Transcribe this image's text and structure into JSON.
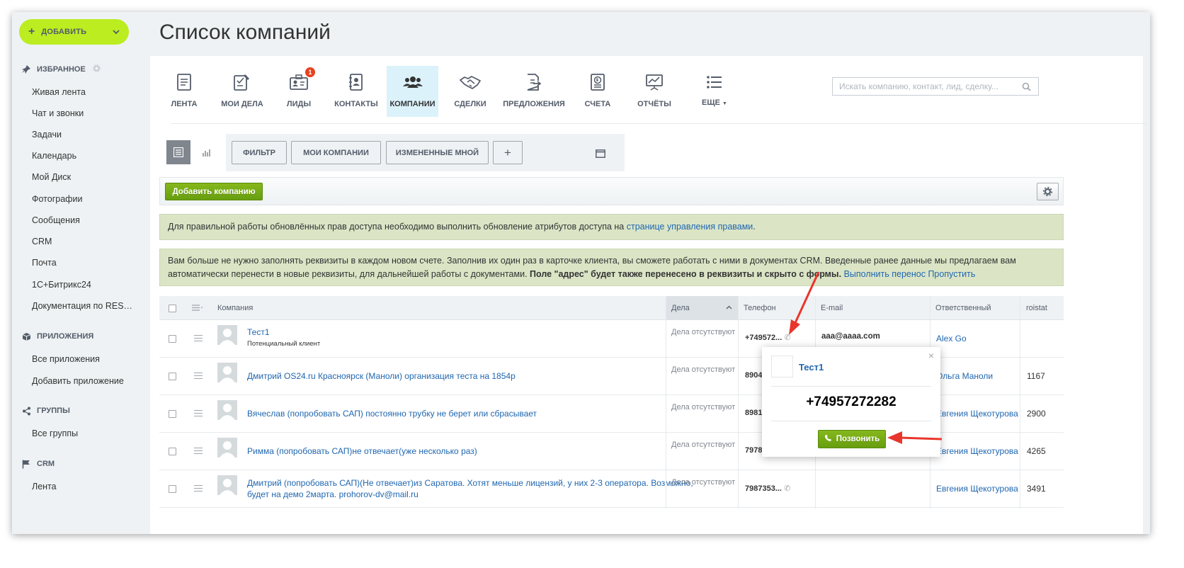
{
  "add_button": {
    "label": "ДОБАВИТЬ"
  },
  "sidebar": {
    "favorites_title": "ИЗБРАННОЕ",
    "favorites": [
      "Живая лента",
      "Чат и звонки",
      "Задачи",
      "Календарь",
      "Мой Диск",
      "Фотографии",
      "Сообщения",
      "CRM",
      "Почта",
      "1С+Битрикс24",
      "Документация по RES…"
    ],
    "apps_title": "ПРИЛОЖЕНИЯ",
    "apps": [
      "Все приложения",
      "Добавить приложение"
    ],
    "groups_title": "ГРУППЫ",
    "groups": [
      "Все группы"
    ],
    "crm_title": "CRM",
    "crm": [
      "Лента"
    ]
  },
  "page_title": "Список компаний",
  "nav_tabs": [
    {
      "label": "ЛЕНТА",
      "icon": "feed-icon"
    },
    {
      "label": "МОИ ДЕЛА",
      "icon": "tasks-icon"
    },
    {
      "label": "ЛИДЫ",
      "icon": "leads-icon",
      "badge": "1"
    },
    {
      "label": "КОНТАКТЫ",
      "icon": "contacts-icon"
    },
    {
      "label": "КОМПАНИИ",
      "icon": "companies-icon",
      "active": true
    },
    {
      "label": "СДЕЛКИ",
      "icon": "handshake-icon"
    },
    {
      "label": "ПРЕДЛОЖЕНИЯ",
      "icon": "proposals-icon"
    },
    {
      "label": "СЧЕТА",
      "icon": "invoice-icon"
    },
    {
      "label": "ОТЧЁТЫ",
      "icon": "reports-icon"
    },
    {
      "label": "ЕЩЕ",
      "icon": "more-list-icon"
    }
  ],
  "search": {
    "placeholder": "Искать компанию, контакт, лид, сделку..."
  },
  "filters": {
    "filter": "ФИЛЬТР",
    "my_companies": "МОИ КОМПАНИИ",
    "changed_by_me": "ИЗМЕНЕННЫЕ МНОЙ",
    "add": "+"
  },
  "add_company": "Добавить компанию",
  "notices": {
    "access_text": "Для правильной работы обновлённых прав доступа необходимо выполнить обновление атрибутов доступа на ",
    "access_link": "странице управления правами",
    "access_end": ".",
    "requisites_text": "Вам больше не нужно заполнять реквизиты в каждом новом счете. Заполнив их один раз в карточке клиента, вы сможете работать с ними в документах CRM. Введенные ранее данные мы предлагаем вам автоматически перенести в новые реквизиты, для дальнейшей работы с документами. ",
    "requisites_bold": "Поле \"адрес\" будет также перенесено в реквизиты и скрыто с формы.",
    "link_transfer": "Выполнить перенос",
    "link_skip": "Пропустить"
  },
  "table": {
    "headers": {
      "company": "Компания",
      "deals": "Дела",
      "phone": "Телефон",
      "email": "E-mail",
      "responsible": "Ответственный",
      "roistat": "roistat"
    },
    "rows": [
      {
        "name": "Тест1",
        "name2": "",
        "sub": "Потенциальный клиент",
        "deals": "Дела отсутствуют",
        "phone": "+749572...",
        "email": "aaa@aaaa.com",
        "responsible": "Alex Go",
        "roistat": ""
      },
      {
        "name": "Дмитрий OS24.ru Красноярск (Маноли) организация теста на 1854р",
        "name2": "",
        "sub": "",
        "deals": "Дела отсутствуют",
        "phone": "8904",
        "email": "",
        "responsible": "Ольга Маноли",
        "roistat": "1167"
      },
      {
        "name": "Вячеслав (попробовать САП) постоянно трубку не берет или сбрасывает",
        "name2": "",
        "sub": "",
        "deals": "Дела отсутствуют",
        "phone": "8981",
        "email": "",
        "responsible": "Евгения Щекотурова",
        "roistat": "2900"
      },
      {
        "name": "Римма (попробовать САП)не отвечает(уже несколько раз)",
        "name2": "",
        "sub": "",
        "deals": "Дела отсутствуют",
        "phone": "7978",
        "email": "",
        "responsible": "Евгения Щекотурова",
        "roistat": "4265"
      },
      {
        "name": "Дмитрий (попробовать САП)(Не отвечает)из Саратова. Хотят меньше лицензий, у них 2-3 оператора. Возможно,",
        "name2": "будет на демо 2марта. prohorov-dv@mail.ru",
        "sub": "",
        "deals": "Дела отсутствуют",
        "phone": "7987353...",
        "email": "",
        "responsible": "Евгения Щекотурова",
        "roistat": "3491"
      }
    ]
  },
  "popup": {
    "name": "Тест1",
    "number": "+74957272282",
    "call": "Позвонить",
    "close": "×"
  },
  "colors": {
    "accent": "#bbed21",
    "link": "#2067b0",
    "green_button": "#6ea914",
    "arrow": "#e8362d",
    "notice_bg": "#dbe5c6"
  }
}
